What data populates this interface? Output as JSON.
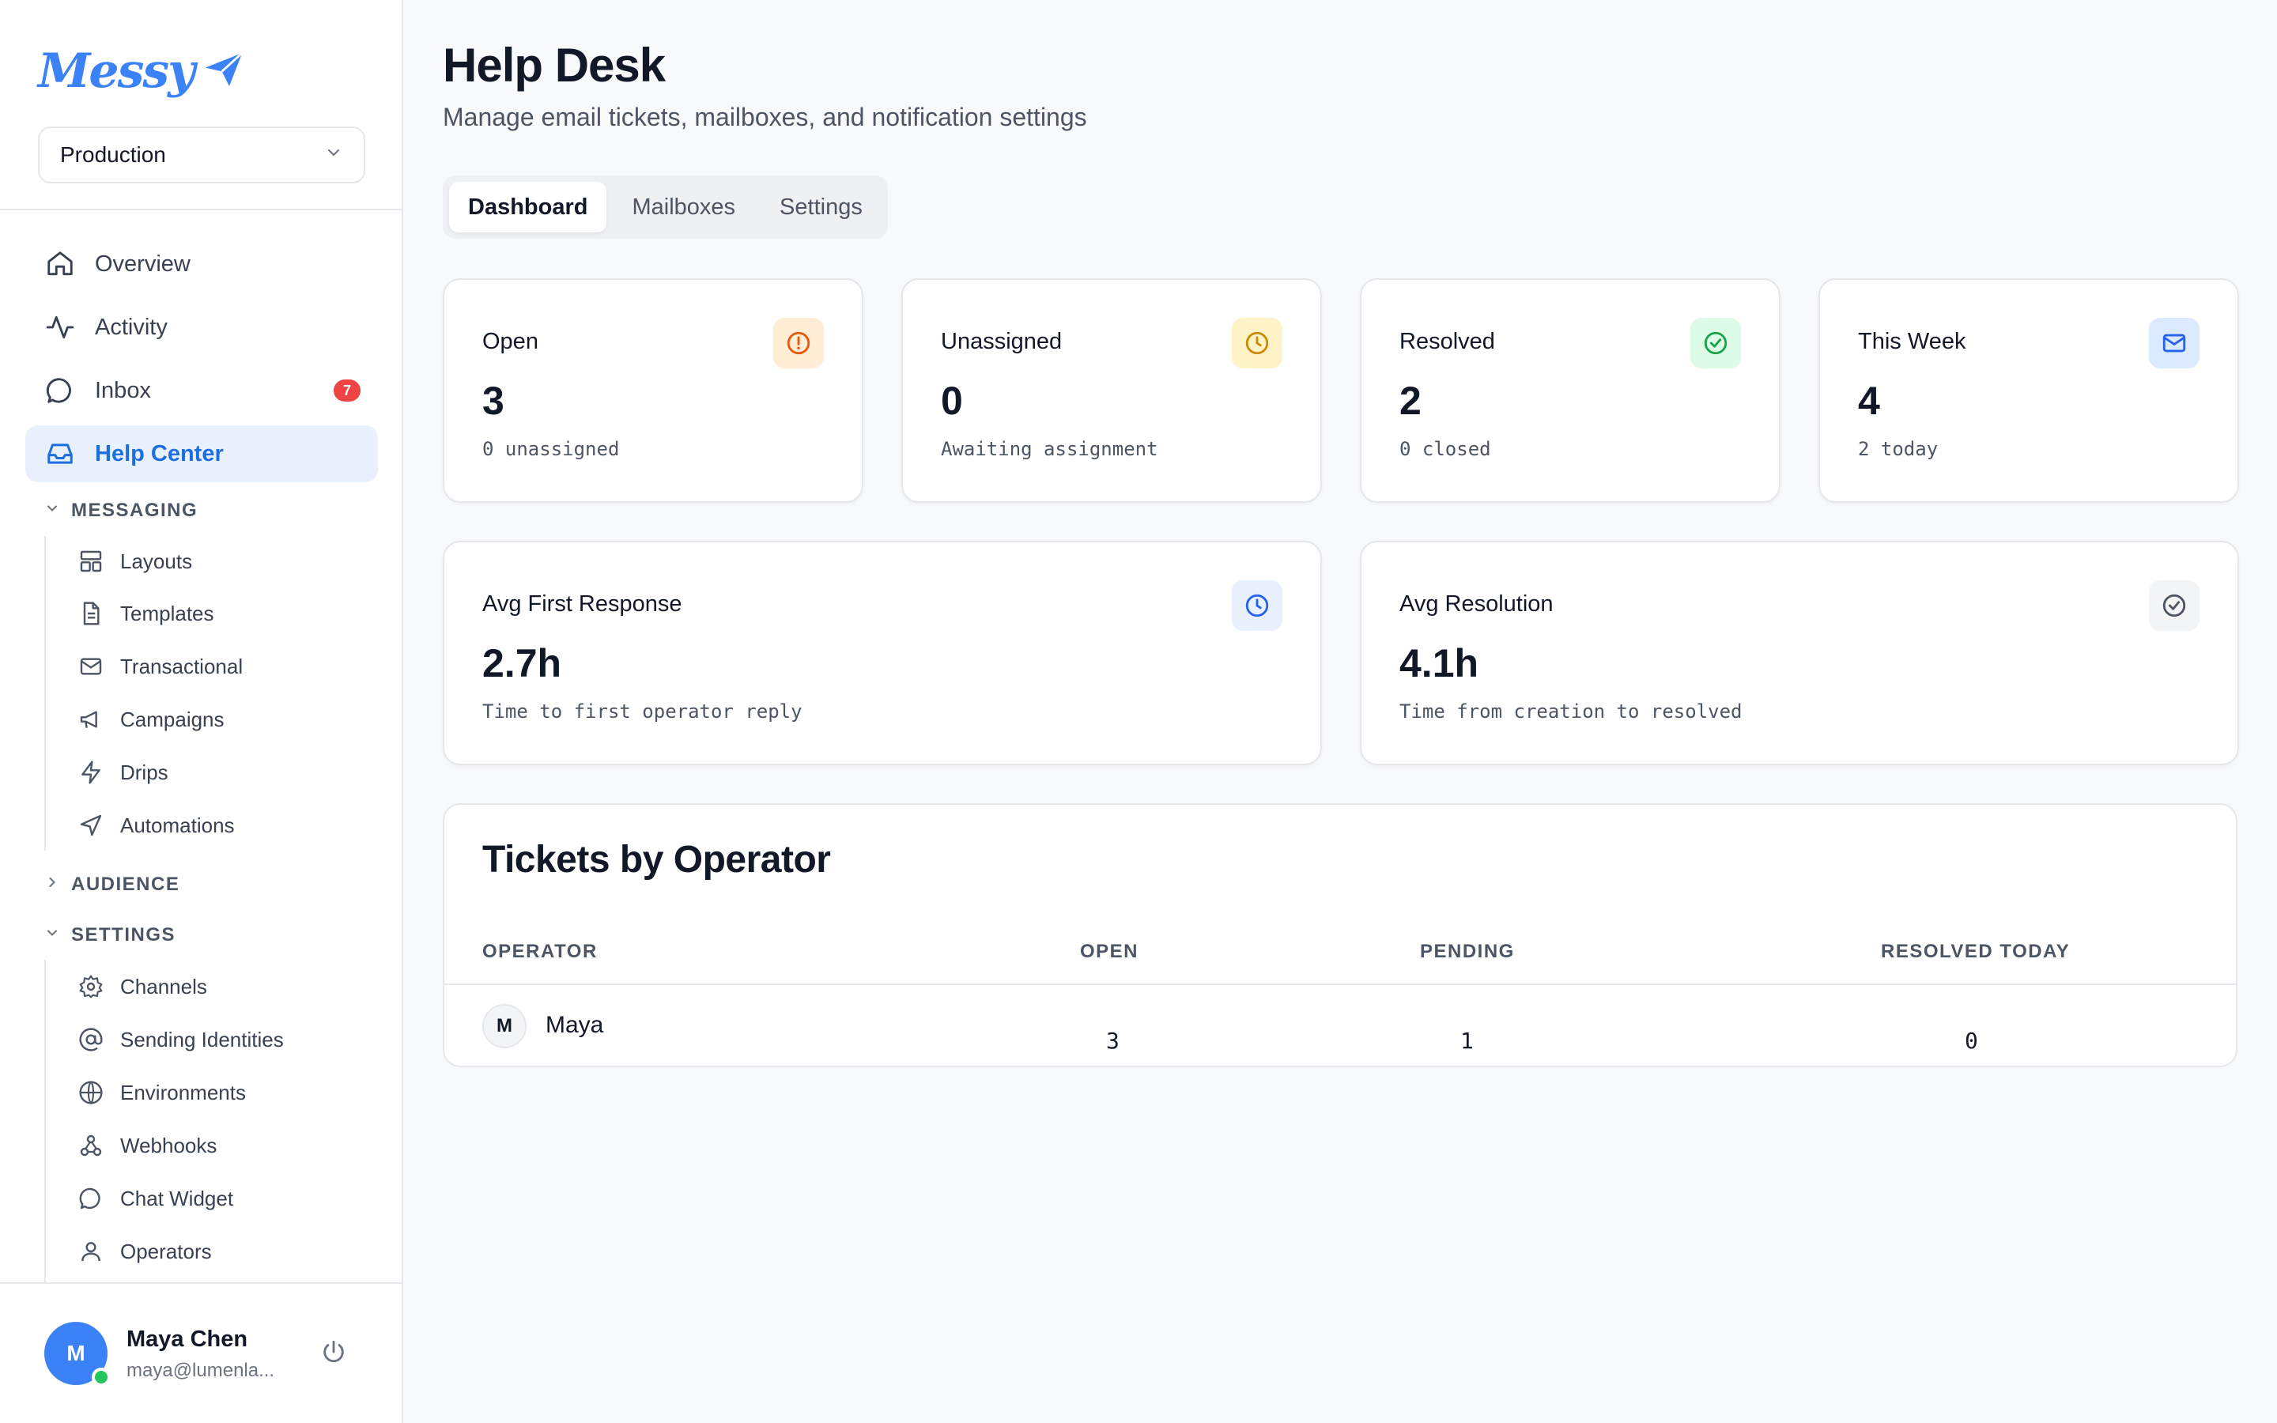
{
  "app": {
    "logo_text": "Messy"
  },
  "environment": {
    "selected": "Production"
  },
  "nav": {
    "overview": "Overview",
    "activity": "Activity",
    "inbox": "Inbox",
    "inbox_badge": "7",
    "help_center": "Help Center"
  },
  "sections": {
    "messaging": {
      "label": "MESSAGING",
      "items": [
        "Layouts",
        "Templates",
        "Transactional",
        "Campaigns",
        "Drips",
        "Automations"
      ]
    },
    "audience": {
      "label": "AUDIENCE"
    },
    "settings": {
      "label": "SETTINGS",
      "items": [
        "Channels",
        "Sending Identities",
        "Environments",
        "Webhooks",
        "Chat Widget",
        "Operators"
      ]
    }
  },
  "user": {
    "initial": "M",
    "name": "Maya Chen",
    "email": "maya@lumenla..."
  },
  "page": {
    "title": "Help Desk",
    "subtitle": "Manage email tickets, mailboxes, and notification settings"
  },
  "tabs": [
    "Dashboard",
    "Mailboxes",
    "Settings"
  ],
  "stats": {
    "open": {
      "label": "Open",
      "value": "3",
      "caption": "0 unassigned"
    },
    "unassigned": {
      "label": "Unassigned",
      "value": "0",
      "caption": "Awaiting assignment"
    },
    "resolved": {
      "label": "Resolved",
      "value": "2",
      "caption": "0 closed"
    },
    "this_week": {
      "label": "This Week",
      "value": "4",
      "caption": "2 today"
    },
    "avg_first_response": {
      "label": "Avg First Response",
      "value": "2.7h",
      "caption": "Time to first operator reply"
    },
    "avg_resolution": {
      "label": "Avg Resolution",
      "value": "4.1h",
      "caption": "Time from creation to resolved"
    }
  },
  "tickets_by_operator": {
    "title": "Tickets by Operator",
    "columns": [
      "OPERATOR",
      "OPEN",
      "PENDING",
      "RESOLVED TODAY"
    ],
    "rows": [
      {
        "initial": "M",
        "name": "Maya",
        "open": "3",
        "pending": "1",
        "resolved_today": "0"
      }
    ]
  },
  "colors": {
    "accent": "#3b82f6",
    "active_nav_bg": "#e8f0fd",
    "badge": "#ef4444",
    "open_icon_bg": "#ffedd5",
    "unassigned_icon_bg": "#fef3c7",
    "resolved_icon_bg": "#dcfce7",
    "week_icon_bg": "#dbeafe"
  }
}
